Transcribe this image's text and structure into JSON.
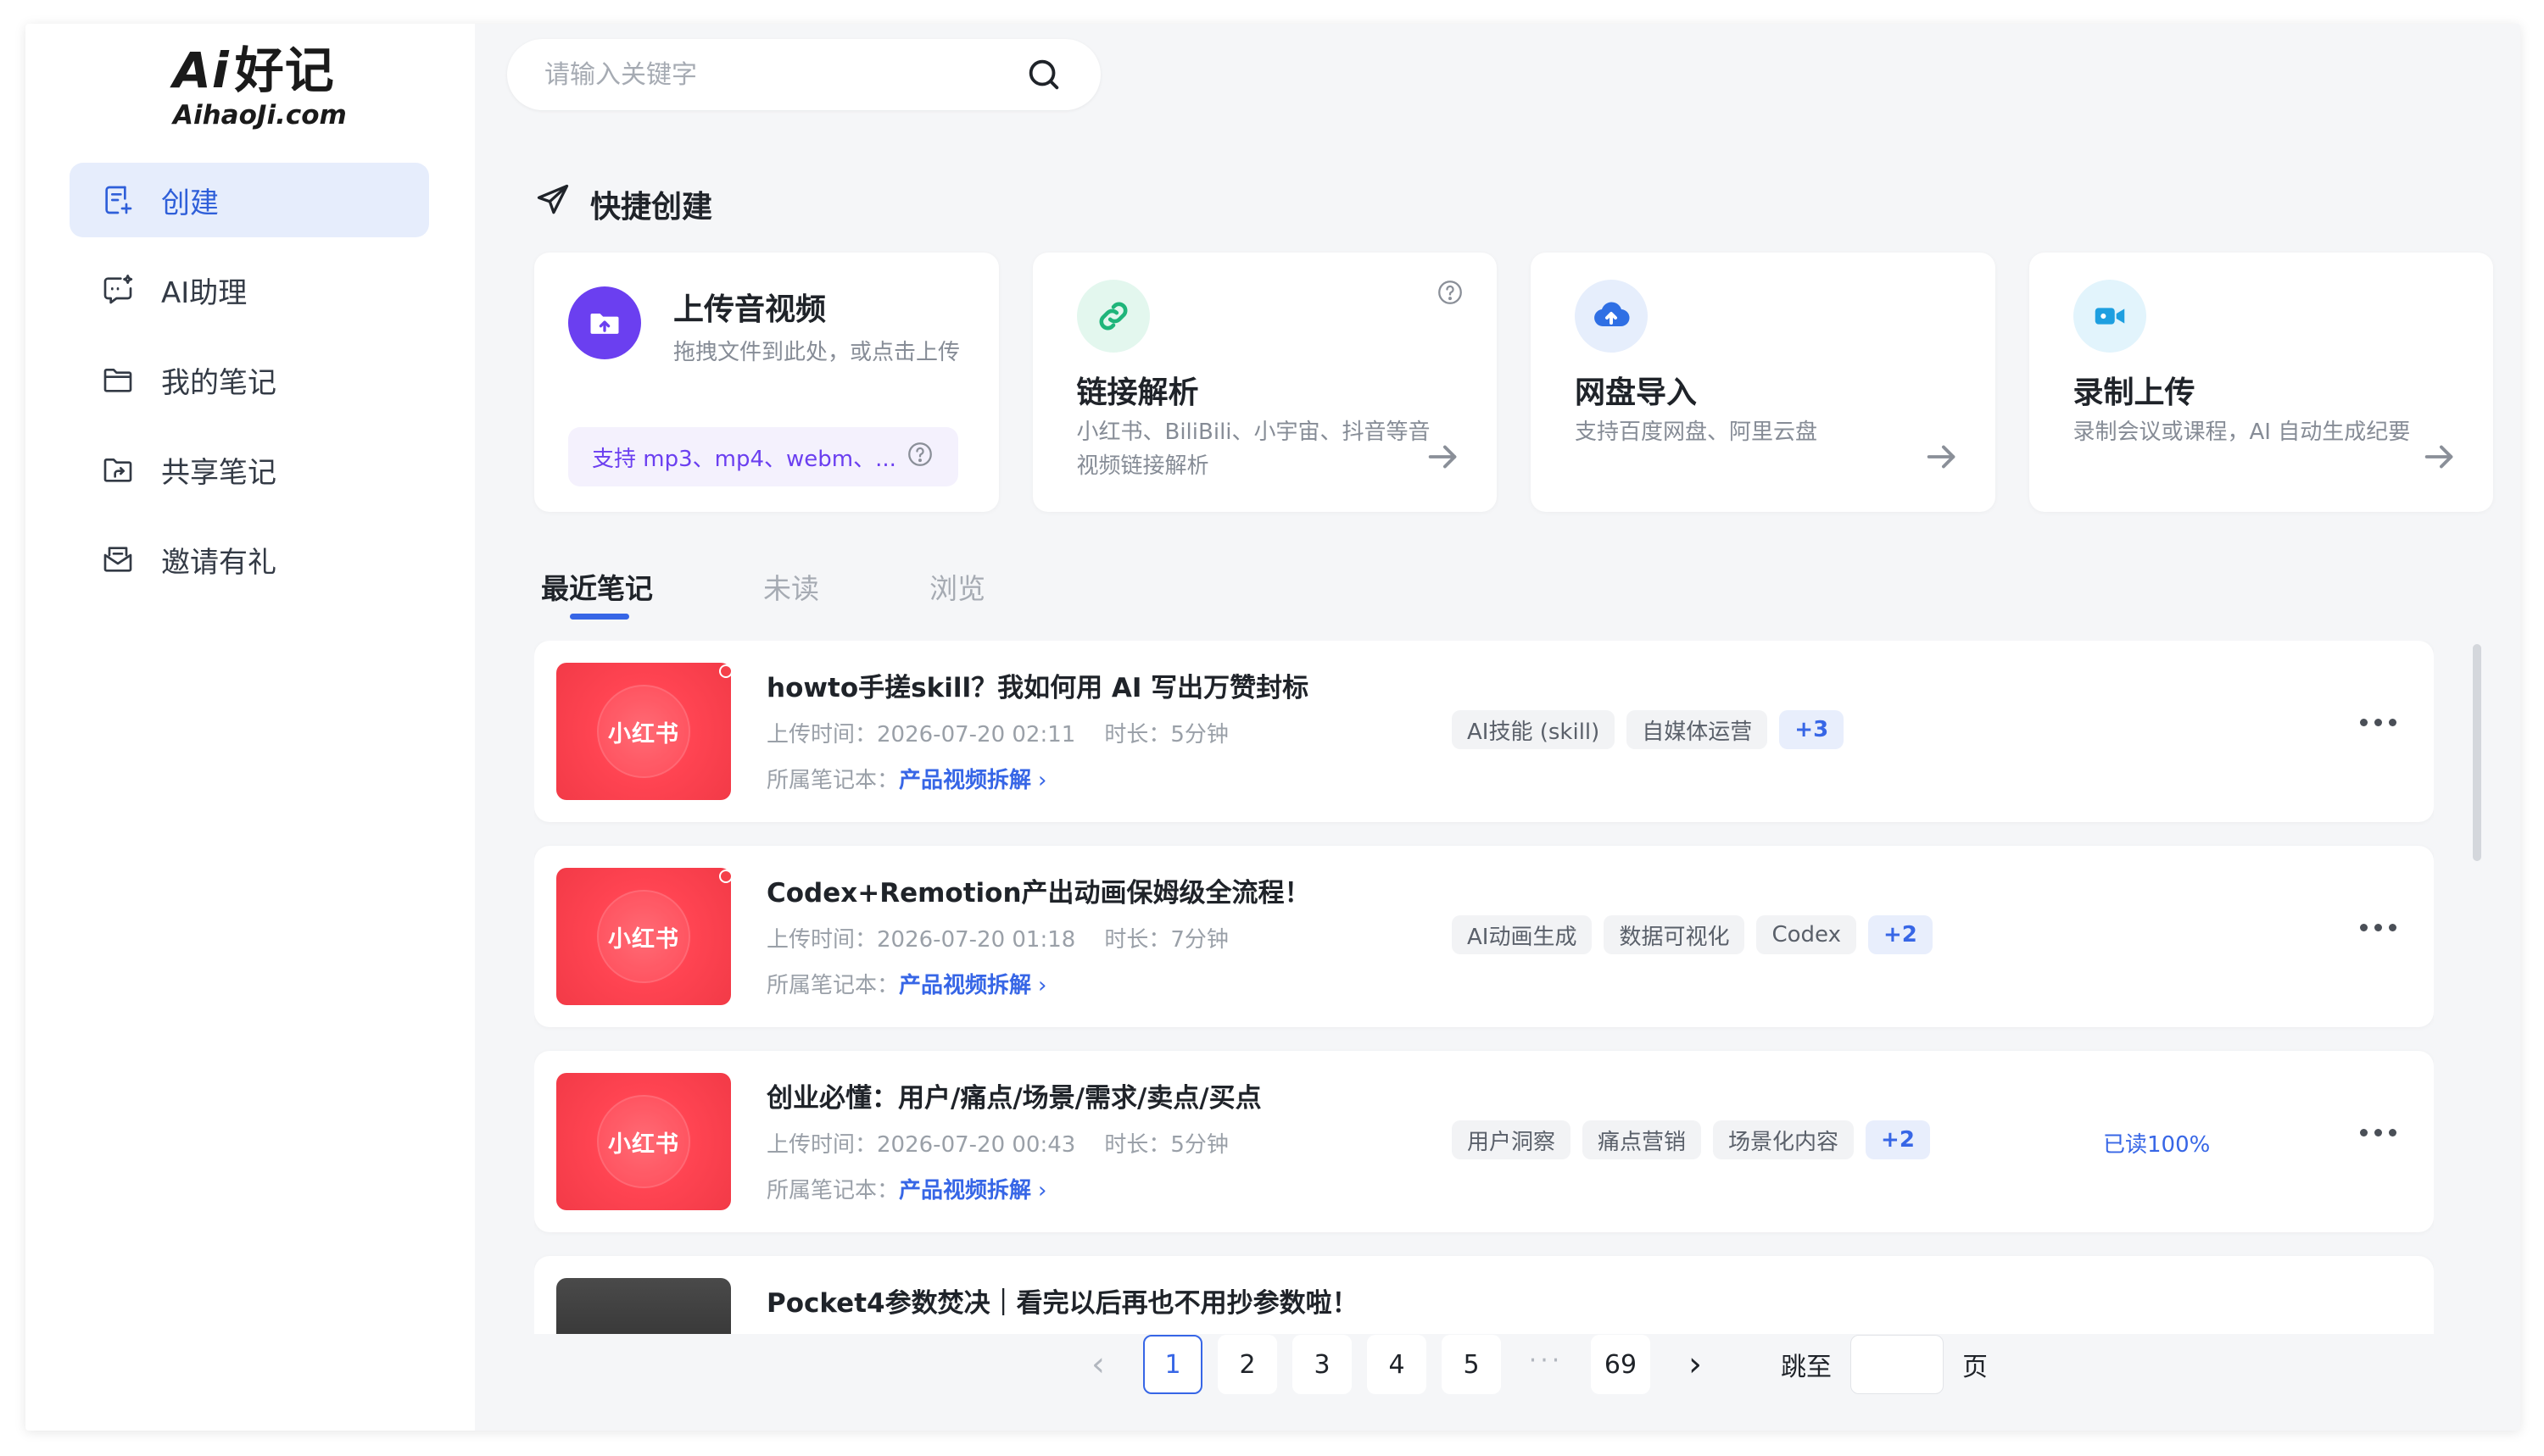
{
  "logo": {
    "ai": "Ai",
    "name": "好记",
    "domain": "AihaoJi.com"
  },
  "sidebar": {
    "items": [
      {
        "label": "创建",
        "icon": "create-note-icon",
        "active": true
      },
      {
        "label": "AI助理",
        "icon": "chat-assistant-icon",
        "active": false
      },
      {
        "label": "我的笔记",
        "icon": "folder-icon",
        "active": false
      },
      {
        "label": "共享笔记",
        "icon": "share-folder-icon",
        "active": false
      },
      {
        "label": "邀请有礼",
        "icon": "mail-gift-icon",
        "active": false
      }
    ]
  },
  "search": {
    "placeholder": "请输入关键字",
    "value": ""
  },
  "quick_create": {
    "title": "快捷创建",
    "upload": {
      "title": "上传音视频",
      "desc": "拖拽文件到此处，或点击上传",
      "formats": "支持 mp3、mp4、webm、..."
    },
    "link": {
      "title": "链接解析",
      "desc": "小红书、BiliBili、小宇宙、抖音等音视频链接解析"
    },
    "cloud": {
      "title": "网盘导入",
      "desc": "支持百度网盘、阿里云盘"
    },
    "record": {
      "title": "录制上传",
      "desc": "录制会议或课程，AI 自动生成纪要"
    }
  },
  "tabs": [
    {
      "label": "最近笔记",
      "active": true
    },
    {
      "label": "未读",
      "active": false
    },
    {
      "label": "浏览",
      "active": false
    }
  ],
  "notes": [
    {
      "thumb_text": "小红书",
      "unread": true,
      "title": "howto手搓skill？我如何用 AI 写出万赞封标",
      "upload_label": "上传时间：",
      "upload_time": "2026-07-20 02:11",
      "duration_label": "时长：",
      "duration": "5分钟",
      "notebook_label": "所属笔记本：",
      "notebook": "产品视频拆解",
      "tags": [
        "AI技能 (skill)",
        "自媒体运营"
      ],
      "more_tags": "+3",
      "read_status": ""
    },
    {
      "thumb_text": "小红书",
      "unread": true,
      "title": "Codex+Remotion产出动画保姆级全流程！",
      "upload_label": "上传时间：",
      "upload_time": "2026-07-20 01:18",
      "duration_label": "时长：",
      "duration": "7分钟",
      "notebook_label": "所属笔记本：",
      "notebook": "产品视频拆解",
      "tags": [
        "AI动画生成",
        "数据可视化",
        "Codex"
      ],
      "more_tags": "+2",
      "read_status": ""
    },
    {
      "thumb_text": "小红书",
      "unread": false,
      "title": "创业必懂：用户/痛点/场景/需求/卖点/买点",
      "upload_label": "上传时间：",
      "upload_time": "2026-07-20 00:43",
      "duration_label": "时长：",
      "duration": "5分钟",
      "notebook_label": "所属笔记本：",
      "notebook": "产品视频拆解",
      "tags": [
        "用户洞察",
        "痛点营销",
        "场景化内容"
      ],
      "more_tags": "+2",
      "read_status": "已读100%"
    },
    {
      "thumb_text": "",
      "unread": false,
      "title": "Pocket4参数焚决｜看完以后再也不用抄参数啦！"
    }
  ],
  "pagination": {
    "pages": [
      "1",
      "2",
      "3",
      "4",
      "5"
    ],
    "current": "1",
    "ellipsis": "···",
    "last": "69",
    "prev": "‹",
    "next": "›",
    "jump_label": "跳至",
    "page_suffix": "页"
  },
  "colors": {
    "accent": "#3766e6",
    "upload_purple": "#6b3ff0",
    "link_green": "#1fb57a",
    "cloud_blue": "#2f6fe4",
    "record_cyan": "#1e9fe0",
    "thumb_red": "#ff4452"
  }
}
